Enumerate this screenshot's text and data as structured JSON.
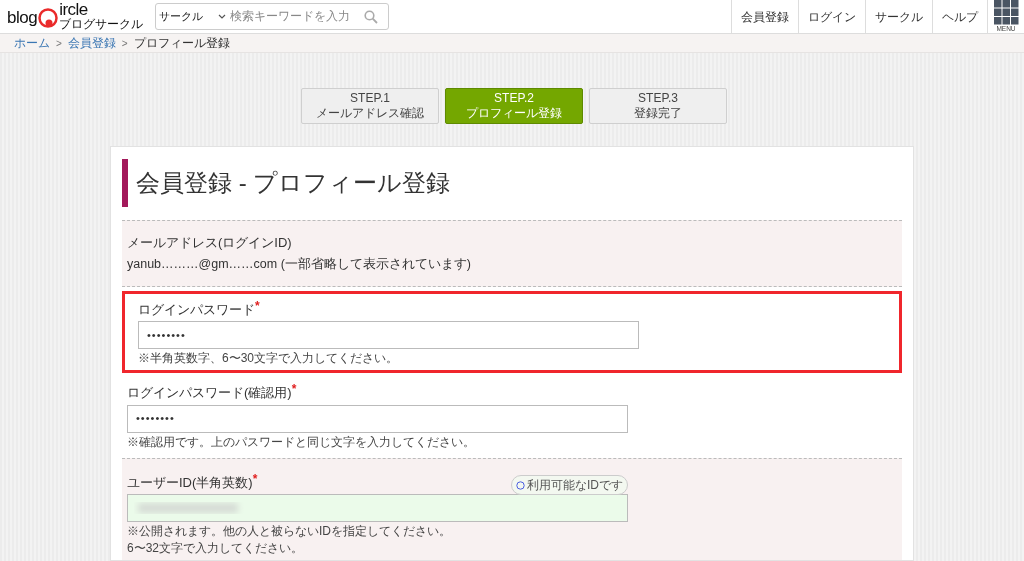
{
  "logo": {
    "left": "blog",
    "right": "ircle",
    "sub": "ブログサークル"
  },
  "search": {
    "category": "サークル",
    "placeholder": "検索キーワードを入力"
  },
  "nav": [
    "会員登録",
    "ログイン",
    "サークル",
    "ヘルプ"
  ],
  "menu_button": {
    "label": "MENU"
  },
  "breadcrumb": [
    {
      "label": "ホーム",
      "link": true
    },
    {
      "label": "会員登録",
      "link": true
    },
    {
      "label": "プロフィール登録",
      "link": false
    }
  ],
  "breadcrumb_separator": ">",
  "steps": [
    {
      "step": "STEP.1",
      "label": "メールアドレス確認",
      "selected": false
    },
    {
      "step": "STEP.2",
      "label": "プロフィール登録",
      "selected": true
    },
    {
      "step": "STEP.3",
      "label": "登録完了",
      "selected": false
    }
  ],
  "title": "会員登録 - プロフィール登録",
  "sections": [
    {
      "kind": "info",
      "shaded": true,
      "label": "メールアドレス(ログインID)",
      "value": "yanub………@gm……com (一部省略して表示されています)"
    },
    {
      "kind": "field",
      "shaded": false,
      "highlighted": true,
      "label": "ログインパスワード",
      "required": "*",
      "value": "••••••••",
      "hints": [
        "※半角英数字、6〜30文字で入力してください。"
      ]
    },
    {
      "kind": "field",
      "shaded": false,
      "highlighted": false,
      "label": "ログインパスワード(確認用)",
      "required": "*",
      "value": "••••••••",
      "hints": [
        "※確認用です。上のパスワードと同じ文字を入力してください。"
      ]
    },
    {
      "kind": "field",
      "shaded": true,
      "highlighted": false,
      "label": "ユーザーID(半角英数)",
      "required": "*",
      "valid": true,
      "status": "利用可能なIDです",
      "hints": [
        "※公開されます。他の人と被らないIDを指定してください。",
        "6〜32文字で入力してください。"
      ]
    }
  ]
}
